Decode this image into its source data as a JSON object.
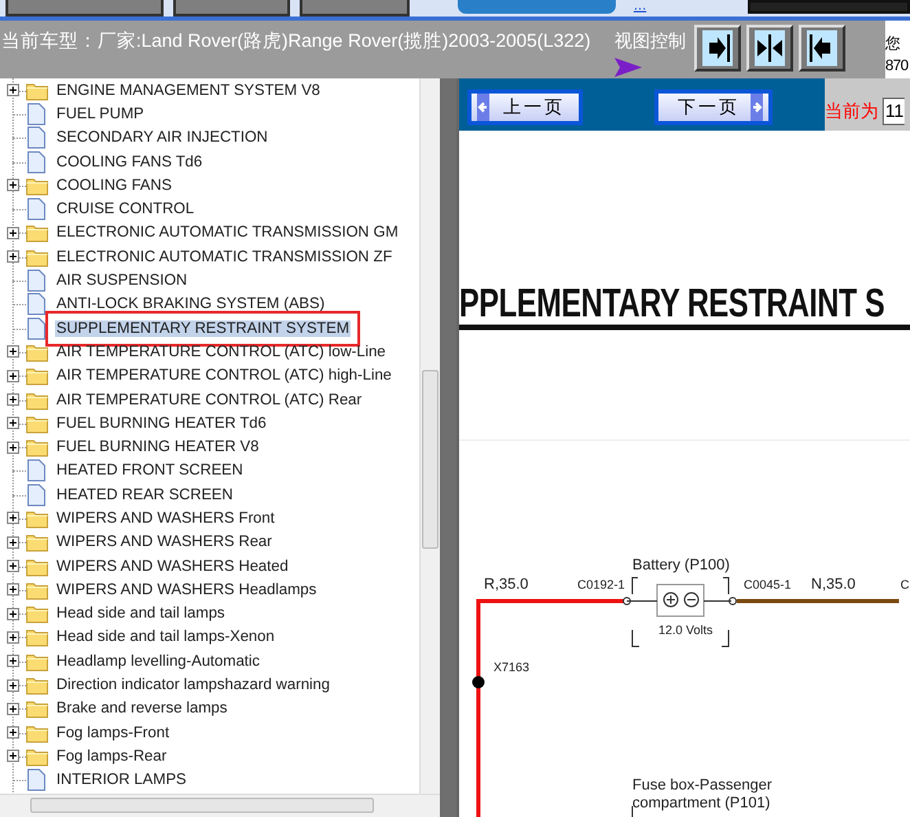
{
  "header": {
    "model_label": "当前车型：厂家:Land Rover(路虎)Range Rover(揽胜)2003-2005(L322)",
    "view_control_label": "视图控制",
    "link_text": "...",
    "side_info": [
      "您",
      "870"
    ]
  },
  "tree": {
    "items": [
      {
        "label": "ENGINE MANAGEMENT SYSTEM V8",
        "kind": "folder",
        "selected": false,
        "outlined": false
      },
      {
        "label": "FUEL PUMP",
        "kind": "page",
        "selected": false,
        "outlined": false
      },
      {
        "label": "SECONDARY AIR INJECTION",
        "kind": "page",
        "selected": false,
        "outlined": false
      },
      {
        "label": "COOLING FANS Td6",
        "kind": "page",
        "selected": false,
        "outlined": false
      },
      {
        "label": "COOLING FANS",
        "kind": "folder",
        "selected": false,
        "outlined": false
      },
      {
        "label": "CRUISE CONTROL",
        "kind": "page",
        "selected": false,
        "outlined": false
      },
      {
        "label": "ELECTRONIC AUTOMATIC TRANSMISSION GM",
        "kind": "folder",
        "selected": false,
        "outlined": false
      },
      {
        "label": "ELECTRONIC AUTOMATIC TRANSMISSION ZF",
        "kind": "folder",
        "selected": false,
        "outlined": false
      },
      {
        "label": "AIR SUSPENSION",
        "kind": "page",
        "selected": false,
        "outlined": false
      },
      {
        "label": "ANTI-LOCK BRAKING SYSTEM (ABS)",
        "kind": "page",
        "selected": false,
        "outlined": false
      },
      {
        "label": "SUPPLEMENTARY RESTRAINT SYSTEM",
        "kind": "page",
        "selected": true,
        "outlined": true
      },
      {
        "label": "AIR TEMPERATURE CONTROL (ATC) low-Line",
        "kind": "folder",
        "selected": false,
        "outlined": false
      },
      {
        "label": "AIR TEMPERATURE CONTROL (ATC) high-Line",
        "kind": "folder",
        "selected": false,
        "outlined": false
      },
      {
        "label": "AIR TEMPERATURE CONTROL (ATC) Rear",
        "kind": "folder",
        "selected": false,
        "outlined": false
      },
      {
        "label": "FUEL BURNING HEATER Td6",
        "kind": "folder",
        "selected": false,
        "outlined": false
      },
      {
        "label": "FUEL BURNING HEATER V8",
        "kind": "folder",
        "selected": false,
        "outlined": false
      },
      {
        "label": "HEATED FRONT SCREEN",
        "kind": "page",
        "selected": false,
        "outlined": false
      },
      {
        "label": "HEATED REAR SCREEN",
        "kind": "page",
        "selected": false,
        "outlined": false
      },
      {
        "label": "WIPERS AND WASHERS Front",
        "kind": "folder",
        "selected": false,
        "outlined": false
      },
      {
        "label": "WIPERS AND WASHERS Rear",
        "kind": "folder",
        "selected": false,
        "outlined": false
      },
      {
        "label": "WIPERS AND WASHERS Heated",
        "kind": "folder",
        "selected": false,
        "outlined": false
      },
      {
        "label": "WIPERS AND WASHERS Headlamps",
        "kind": "folder",
        "selected": false,
        "outlined": false
      },
      {
        "label": "Head side and tail lamps",
        "kind": "folder",
        "selected": false,
        "outlined": false
      },
      {
        "label": "Head side and tail lamps-Xenon",
        "kind": "folder",
        "selected": false,
        "outlined": false
      },
      {
        "label": "Headlamp levelling-Automatic",
        "kind": "folder",
        "selected": false,
        "outlined": false
      },
      {
        "label": "Direction indicator lampshazard warning",
        "kind": "folder",
        "selected": false,
        "outlined": false
      },
      {
        "label": "Brake and reverse lamps",
        "kind": "folder",
        "selected": false,
        "outlined": false
      },
      {
        "label": "Fog lamps-Front",
        "kind": "folder",
        "selected": false,
        "outlined": false
      },
      {
        "label": "Fog lamps-Rear",
        "kind": "folder",
        "selected": false,
        "outlined": false
      },
      {
        "label": "INTERIOR LAMPS",
        "kind": "page",
        "selected": false,
        "outlined": false
      }
    ]
  },
  "pager": {
    "prev": "上一页",
    "next": "下一页",
    "current_label": "当前为",
    "current_value": "11"
  },
  "document": {
    "heading": "PPLEMENTARY RESTRAINT S",
    "diagram": {
      "labels": [
        {
          "text": "R,35.0"
        },
        {
          "text": "C0192-1"
        },
        {
          "text": "Battery (P100)"
        },
        {
          "text": "12.0 Volts"
        },
        {
          "text": "C0045-1"
        },
        {
          "text": "N,35.0"
        },
        {
          "text": "C"
        },
        {
          "text": "X7163"
        },
        {
          "text": "Fuse box-Passenger"
        },
        {
          "text": "compartment (P101)"
        }
      ],
      "wires": [
        {
          "color": "#ee1111"
        },
        {
          "color": "#7a4a12"
        }
      ]
    }
  }
}
